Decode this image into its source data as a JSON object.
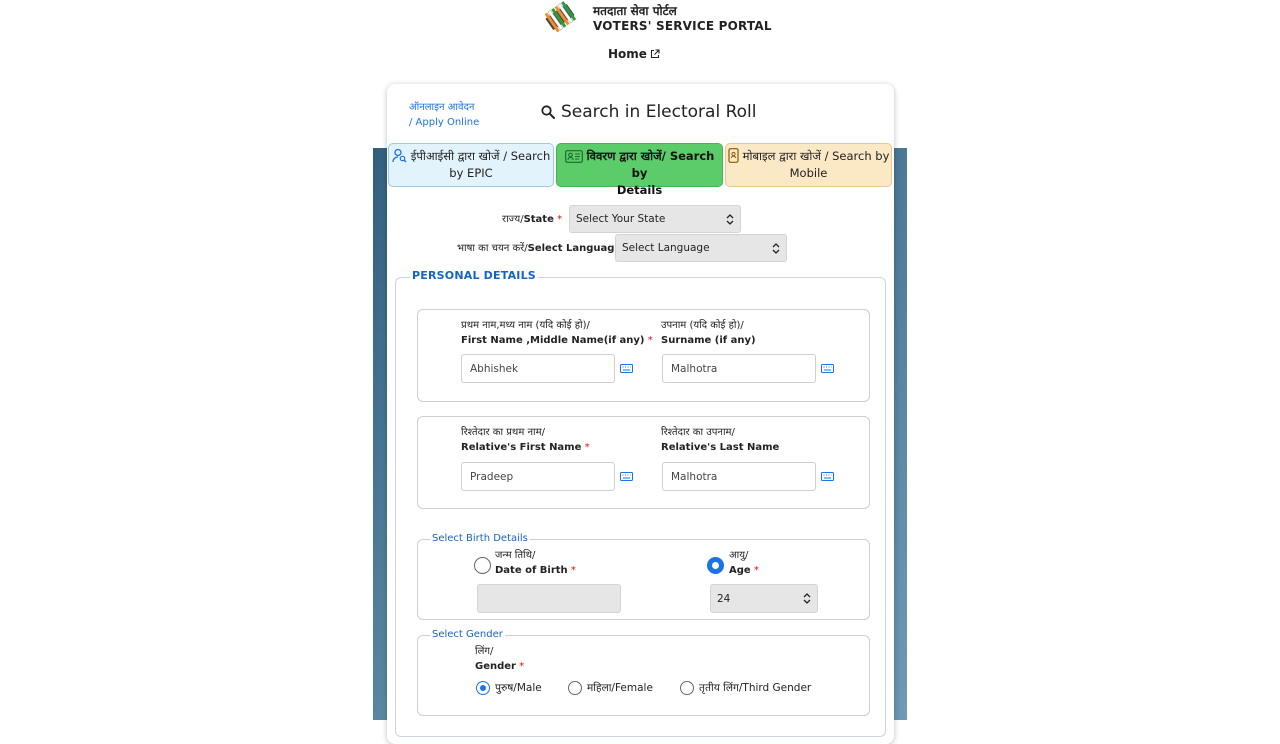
{
  "header": {
    "portal_title_hi": "मतदाता सेवा पोर्टल",
    "portal_title_en": "VOTERS' SERVICE PORTAL",
    "home_link": "Home"
  },
  "card": {
    "apply_online_hi": "ऑनलाइन आवेदन",
    "apply_online_en": "/ Apply Online",
    "title": "Search in Electoral Roll"
  },
  "tabs": [
    {
      "label_line1": "ईपीआईसी द्वारा खोजें / Search",
      "label_line2": "by EPIC",
      "icon": "user-search-icon",
      "active": false
    },
    {
      "label_line1": "विवरण द्वारा खोजें/ Search by",
      "label_line2": "Details",
      "icon": "id-card-icon",
      "active": true
    },
    {
      "label_line1": "मोबाइल द्वारा खोजें / Search by",
      "label_line2": "Mobile",
      "icon": "mobile-icon",
      "active": false
    }
  ],
  "state": {
    "label_hi": "राज्य/",
    "label_en": "State",
    "required": "*",
    "value": "Select Your State"
  },
  "language": {
    "label_hi": "भाषा का चयन करें/",
    "label_en": "Select Language",
    "value": "Select Language"
  },
  "personal_details": {
    "legend": "PERSONAL DETAILS",
    "first_name": {
      "label_hi": "प्रथम नाम,मध्य नाम (यदि कोई हो)/",
      "label_en": "First Name ,Middle Name(if any)",
      "required": "*",
      "value": "Abhishek"
    },
    "surname": {
      "label_hi": "उपनाम (यदि कोई हो)/",
      "label_en": "Surname (if any)",
      "value": "Malhotra"
    },
    "relative_first": {
      "label_hi": "रिश्तेदार का प्रथम नाम/",
      "label_en": "Relative's First Name",
      "required": "*",
      "value": "Pradeep"
    },
    "relative_last": {
      "label_hi": "रिश्तेदार का उपनाम/",
      "label_en": "Relative's Last Name",
      "value": "Malhotra"
    }
  },
  "birth": {
    "legend": "Select Birth Details",
    "dob_hi": "जन्म तिथि/",
    "dob_en": "Date of Birth",
    "age_hi": "आयु/",
    "age_en": "Age",
    "required": "*",
    "selected": "age",
    "age_value": "24"
  },
  "gender": {
    "legend": "Select Gender",
    "label_hi": "लिंग/",
    "label_en": "Gender",
    "required": "*",
    "options": [
      "पुरुष/Male",
      "महिला/Female",
      "तृतीय लिंग/Third Gender"
    ],
    "selected": "पुरुष/Male"
  },
  "colors": {
    "accent": "#1a73e8",
    "legend_blue": "#1565c0",
    "tab_epic_bg": "#e3f3fb",
    "tab_details_bg": "#5ccb6a",
    "tab_mobile_bg": "#fbe8c5",
    "required_red": "#dd1111"
  }
}
